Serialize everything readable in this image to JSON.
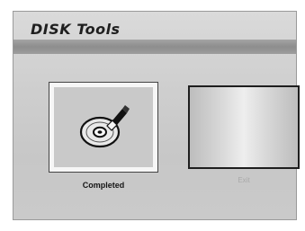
{
  "window": {
    "title": "DISK Tools"
  },
  "options": {
    "completed_label": "Completed",
    "exit_label": "Exit"
  },
  "icons": {
    "completed": "disc-icon"
  },
  "colors": {
    "panel": "#cfcfcf",
    "title_bar": "#8d8d8d",
    "selected_box": "#f6f6f6"
  }
}
